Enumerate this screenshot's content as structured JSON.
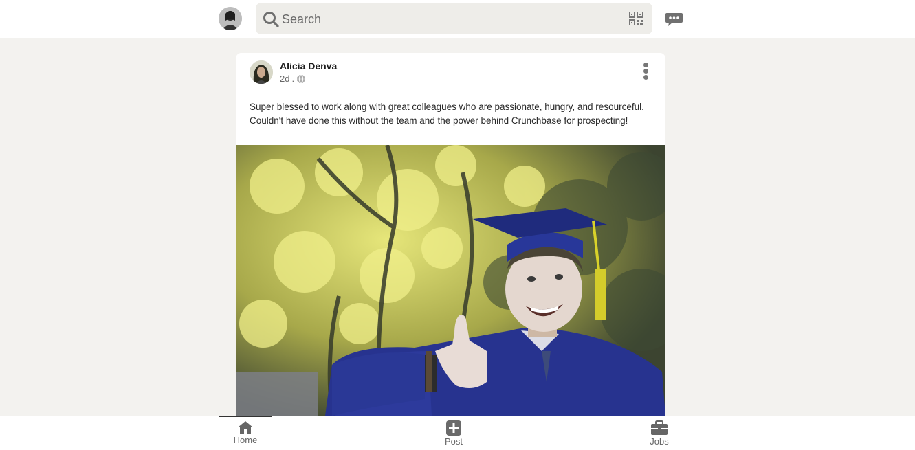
{
  "header": {
    "search": {
      "placeholder": "Search",
      "value": ""
    },
    "icons": {
      "search": "search-icon",
      "qr": "qr-code-icon",
      "messages": "messaging-icon"
    }
  },
  "post": {
    "author": "Alicia Denva",
    "age": "2d",
    "separator": ".",
    "visibility_icon": "globe-icon",
    "text": "Super blessed to work along with great colleagues who are passionate, hungry, and resourceful. Couldn't have done this without the team and the power behind Crunchbase for prospecting!",
    "image_subject": "graduate in cap and gown giving thumbs up"
  },
  "nav": {
    "items": [
      {
        "label": "Home",
        "icon": "home-icon",
        "active": true
      },
      {
        "label": "Post",
        "icon": "plus-square-icon",
        "active": false
      },
      {
        "label": "Jobs",
        "icon": "briefcase-icon",
        "active": false
      }
    ]
  },
  "colors": {
    "background": "#f3f2ef",
    "card": "#ffffff",
    "search_bg": "#eeede9",
    "icon_gray": "#6f6f6f"
  }
}
